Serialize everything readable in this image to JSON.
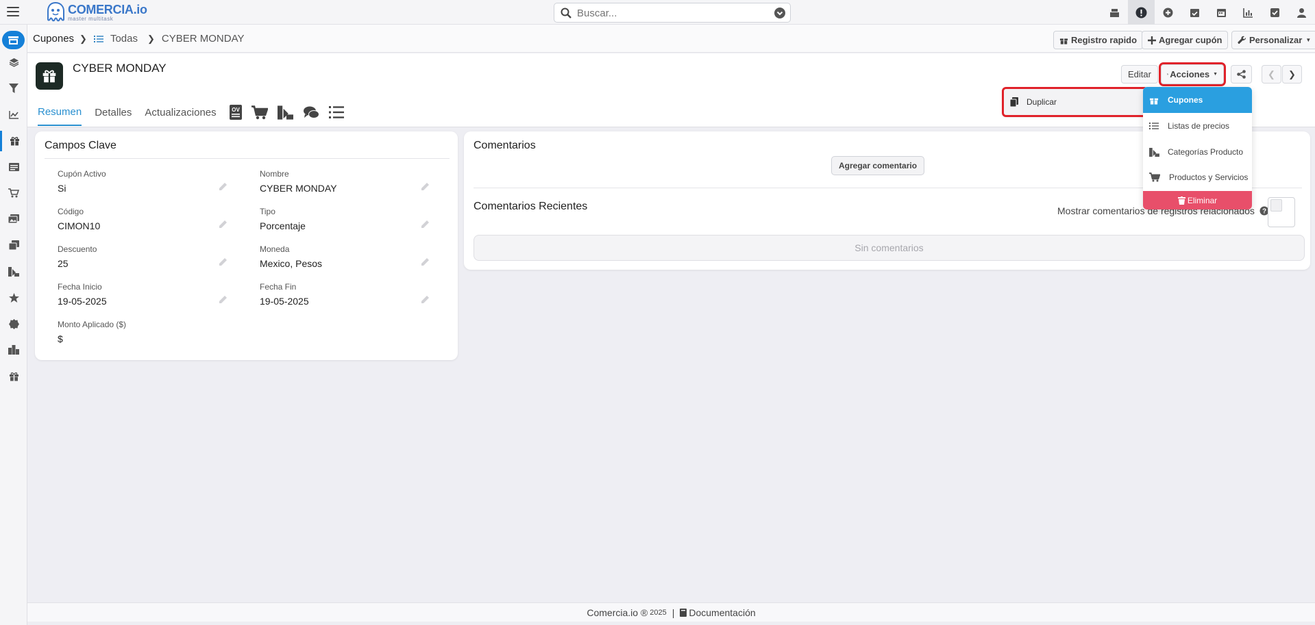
{
  "app": {
    "name": "COMERCIA.io",
    "tagline": "master multitask"
  },
  "search": {
    "placeholder": "Buscar..."
  },
  "breadcrumb": {
    "module": "Cupones",
    "list": "Todas",
    "record": "CYBER MONDAY"
  },
  "toolbar": {
    "quick_register": "Registro rapido",
    "add_coupon": "Agregar cupón",
    "customize": "Personalizar"
  },
  "record": {
    "title": "CYBER MONDAY"
  },
  "tabs": {
    "summary": "Resumen",
    "details": "Detalles",
    "updates": "Actualizaciones"
  },
  "actions": {
    "edit": "Editar",
    "actions": "Acciones"
  },
  "actions_menu": {
    "duplicate": "Duplicar",
    "items": [
      "Cupones",
      "Listas de precios",
      "Categorías Producto",
      "Productos y Servicios"
    ],
    "delete": "Eliminar"
  },
  "key_fields": {
    "title": "Campos Clave",
    "fields": [
      {
        "label": "Cupón Activo",
        "value": "Si"
      },
      {
        "label": "Nombre",
        "value": "CYBER MONDAY"
      },
      {
        "label": "Código",
        "value": "CIMON10"
      },
      {
        "label": "Tipo",
        "value": "Porcentaje"
      },
      {
        "label": "Descuento",
        "value": "25"
      },
      {
        "label": "Moneda",
        "value": "Mexico, Pesos"
      },
      {
        "label": "Fecha Inicio",
        "value": "19-05-2025"
      },
      {
        "label": "Fecha Fin",
        "value": "19-05-2025"
      },
      {
        "label": "Monto Aplicado ($)",
        "value": "$"
      }
    ]
  },
  "comments": {
    "title": "Comentarios",
    "add_button": "Agregar comentario",
    "recent_title": "Comentarios Recientes",
    "show_related": "Mostrar comentarios de registros relacionados",
    "empty": "Sin comentarios"
  },
  "footer": {
    "brand": "Comercia.io ®",
    "year": "2025",
    "separator": "|",
    "docs": "Documentación"
  },
  "colors": {
    "accent": "#2a90d0",
    "highlight": "#e0222a",
    "danger": "#e84f6a"
  }
}
